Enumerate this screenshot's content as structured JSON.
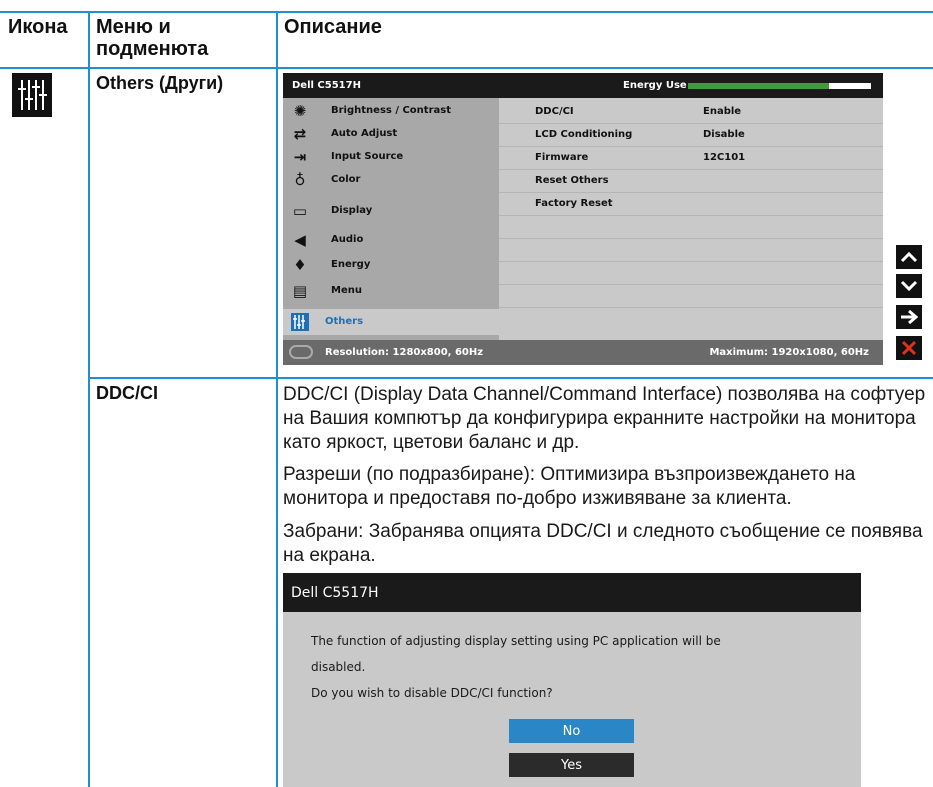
{
  "table": {
    "headers": {
      "icon": "Икона",
      "menu": "Меню и подменюта",
      "description": "Описание"
    }
  },
  "row1": {
    "icon_name": "others-sliders-icon",
    "menu_label": "Others (Други)"
  },
  "osd": {
    "model": "Dell C5517H",
    "energy_label": "Energy Use",
    "energy_level_fraction": 0.77,
    "menu_items": [
      {
        "label": "Brightness / Contrast",
        "icon": "brightness-icon"
      },
      {
        "label": "Auto Adjust",
        "icon": "auto-adjust-icon"
      },
      {
        "label": "Input Source",
        "icon": "input-source-icon"
      },
      {
        "label": "Color",
        "icon": "color-icon"
      },
      {
        "label": "Display",
        "icon": "display-icon"
      },
      {
        "label": "Audio",
        "icon": "audio-icon"
      },
      {
        "label": "Energy",
        "icon": "energy-icon"
      },
      {
        "label": "Menu",
        "icon": "menu-icon"
      },
      {
        "label": "Others",
        "icon": "others-icon"
      }
    ],
    "active_item": "Others",
    "submenu": [
      {
        "label": "DDC/CI",
        "value": "Enable"
      },
      {
        "label": "LCD Conditioning",
        "value": "Disable"
      },
      {
        "label": "Firmware",
        "value": "12C101"
      },
      {
        "label": "Reset Others",
        "value": ""
      },
      {
        "label": "Factory Reset",
        "value": ""
      }
    ],
    "resolution": "Resolution: 1280x800, 60Hz",
    "maximum": "Maximum: 1920x1080, 60Hz",
    "nav_buttons": [
      {
        "name": "up-arrow-icon",
        "glyph": "^"
      },
      {
        "name": "down-arrow-icon",
        "glyph": "v"
      },
      {
        "name": "right-arrow-icon",
        "glyph": "→"
      },
      {
        "name": "close-icon",
        "glyph": "✕"
      }
    ],
    "colors": {
      "accent": "#1f6fb5",
      "energy_green": "#3c9d3a",
      "close_red": "#e0301e",
      "table_line": "#1f8fcf"
    }
  },
  "row2": {
    "menu_label": "DDC/CI",
    "para1": "DDC/CI (Display Data Channel/Command Interface) позволява на софтуер на Вашия компютър да конфигурира екранните настройки на монитора като яркост, цветови баланс и др.",
    "para2": "Разреши (по подразбиране): Оптимизира възпроизвеждането на монитора и предоставя по-добро изживяване за клиента.",
    "para3": "Забрани: Забранява опцията DDC/CI и следното съобщение се появява на екрана."
  },
  "dialog": {
    "title": "Dell C5517H",
    "line1": "The function of adjusting display setting using PC application will be",
    "line2": "disabled.",
    "line3": "Do you wish to disable DDC/CI function?",
    "no_label": "No",
    "yes_label": "Yes"
  }
}
